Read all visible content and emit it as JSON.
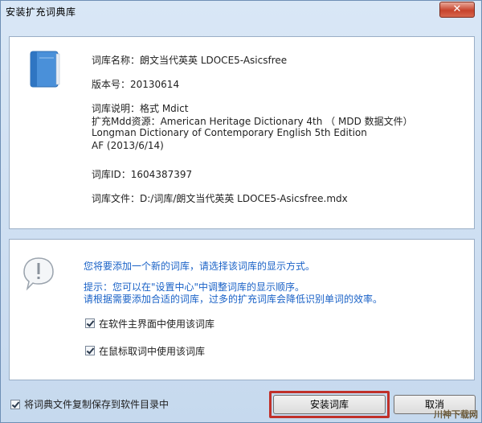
{
  "window": {
    "title": "安装扩充词典库",
    "close_label": "✕"
  },
  "dictionary_info": {
    "name": "词库名称：朗文当代英英 LDOCE5-Asicsfree",
    "version": "版本号：20130614",
    "description_lines": [
      "词库说明：格式 Mdict",
      "扩充Mdd资源：American Heritage Dictionary 4th （ MDD 数据文件）",
      "Longman Dictionary of Contemporary English 5th Edition",
      "AF (2013/6/14)"
    ],
    "id": "词库ID：1604387397",
    "file": "词库文件：D:/词库/朗文当代英英 LDOCE5-Asicsfree.mdx"
  },
  "notice": {
    "prompt": "您将要添加一个新的词库，请选择该词库的显示方式。",
    "hint_line1": "提示：您可以在\"设置中心\"中调整词库的显示顺序。",
    "hint_line2": "请根据需要添加合适的词库，过多的扩充词库会降低识别单词的效率。",
    "option_main_ui": "在软件主界面中使用该词库",
    "option_mouse_lookup": "在鼠标取词中使用该词库"
  },
  "footer": {
    "copy_option": "将词典文件复制保存到软件目录中",
    "install_button": "安装词库",
    "cancel_button": "取消"
  },
  "watermark": "川神下载网"
}
